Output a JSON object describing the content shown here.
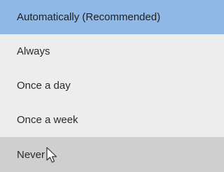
{
  "dropdown": {
    "items": [
      {
        "label": "Automatically (Recommended)",
        "state": "selected"
      },
      {
        "label": "Always",
        "state": "normal"
      },
      {
        "label": "Once a day",
        "state": "normal"
      },
      {
        "label": "Once a week",
        "state": "normal"
      },
      {
        "label": "Never",
        "state": "hover"
      }
    ]
  },
  "colors": {
    "selected_bg": "#8fb8e6",
    "hover_bg": "#cfcfcf",
    "list_bg": "#ededed",
    "text": "#2a2a2a"
  },
  "icons": {
    "cursor": "mouse-pointer-icon"
  }
}
